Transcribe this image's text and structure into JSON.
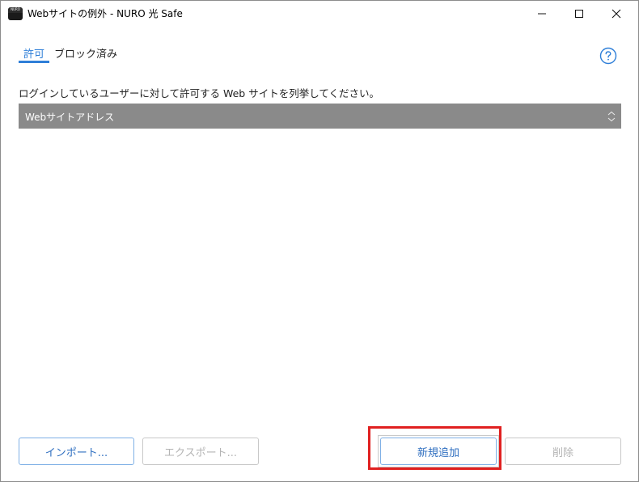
{
  "window": {
    "title": "Webサイトの例外 - NURO 光 Safe",
    "app_icon_text": "NURO"
  },
  "tabs": [
    {
      "label": "許可",
      "selected": true
    },
    {
      "label": "ブロック済み",
      "selected": false
    }
  ],
  "description": "ログインしているユーザーに対して許可する Web サイトを列挙してください。",
  "table": {
    "columns": [
      "Webサイトアドレス"
    ],
    "rows": []
  },
  "buttons": {
    "import": "インポート...",
    "export": "エクスポート...",
    "add": "新規追加",
    "delete": "削除"
  },
  "colors": {
    "accent": "#2f7fd8",
    "header_bg": "#8a8a8a",
    "highlight": "#e02020",
    "disabled_text": "#b4b4b4"
  }
}
